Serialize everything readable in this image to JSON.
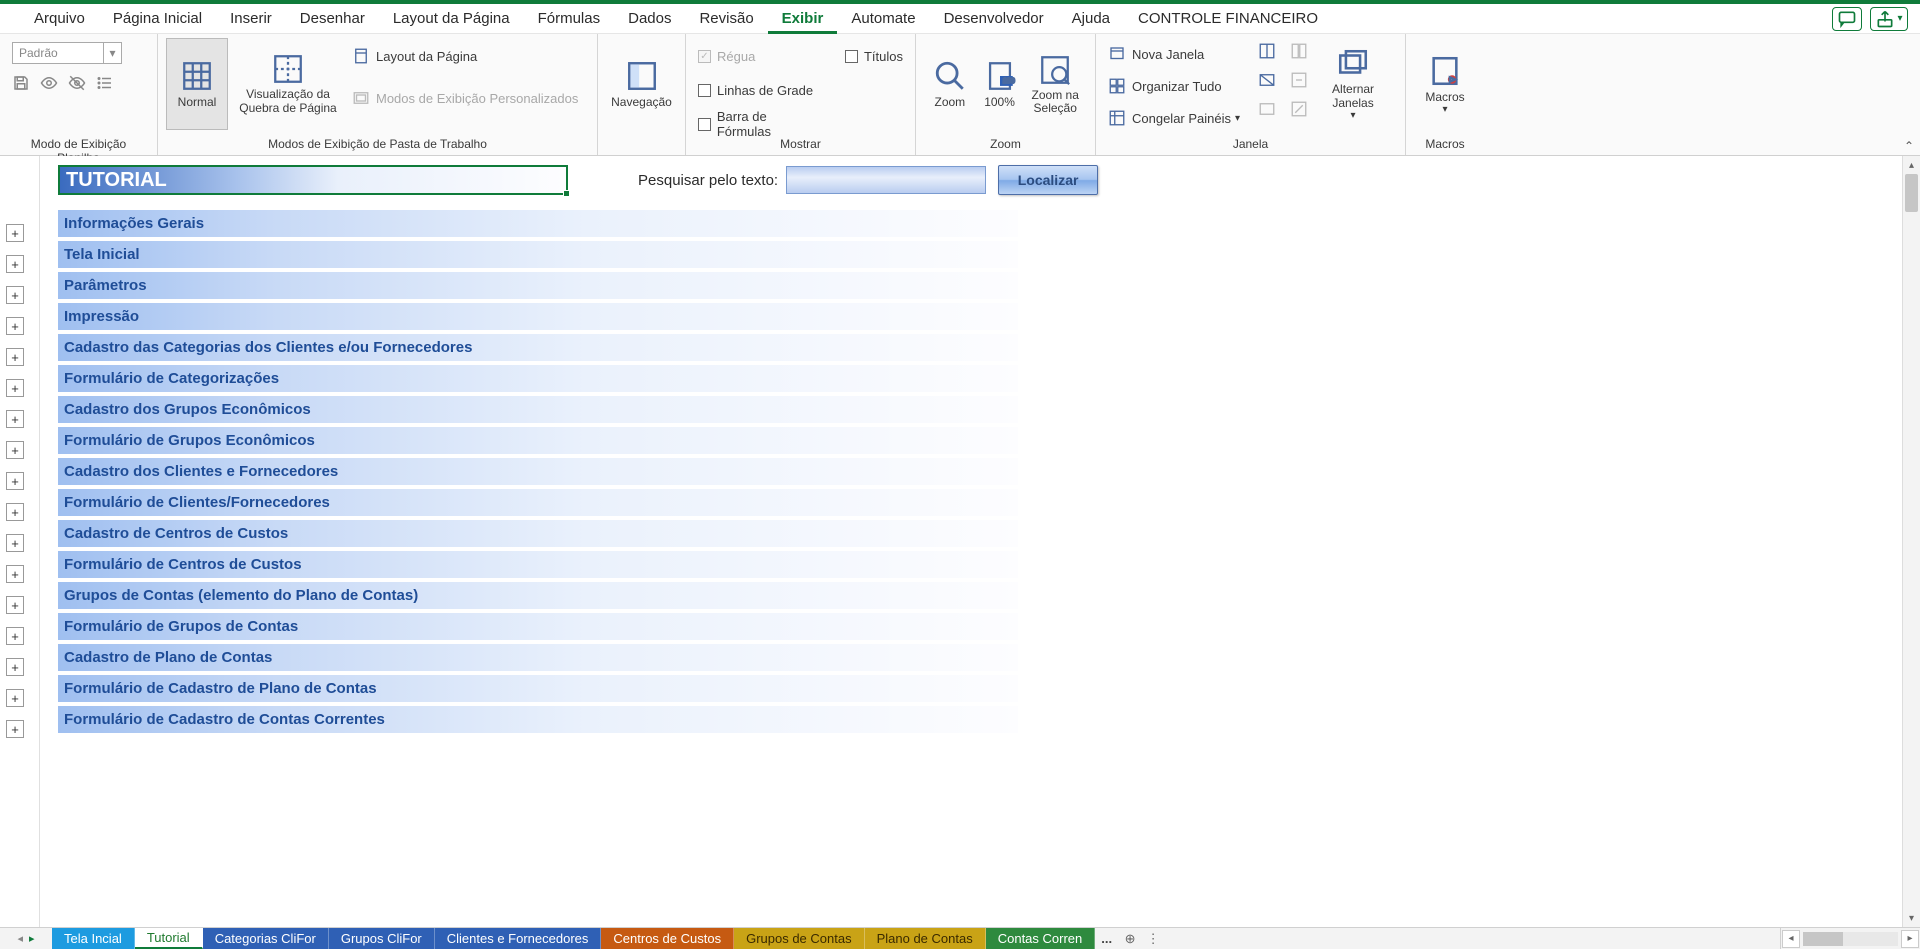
{
  "menubar": {
    "tabs": [
      "Arquivo",
      "Página Inicial",
      "Inserir",
      "Desenhar",
      "Layout da Página",
      "Fórmulas",
      "Dados",
      "Revisão",
      "Exibir",
      "Automate",
      "Desenvolvedor",
      "Ajuda",
      "CONTROLE FINANCEIRO"
    ],
    "active_index": 8
  },
  "ribbon": {
    "group1": {
      "label": "Modo de Exibição Planilha",
      "style_value": "Padrão"
    },
    "group2": {
      "label": "Modos de Exibição de Pasta de Trabalho",
      "normal": "Normal",
      "quebra": "Visualização da Quebra de Página",
      "layout": "Layout da Página",
      "personalizados": "Modos de Exibição Personalizados"
    },
    "group3": {
      "label": "",
      "navegacao": "Navegação"
    },
    "group4": {
      "label": "Mostrar",
      "regua": "Régua",
      "linhas": "Linhas de Grade",
      "barra": "Barra de Fórmulas",
      "titulos": "Títulos"
    },
    "group5": {
      "label": "Zoom",
      "zoom": "Zoom",
      "cem": "100%",
      "selecao": "Zoom na Seleção"
    },
    "group6": {
      "label": "Janela",
      "nova": "Nova Janela",
      "organizar": "Organizar Tudo",
      "congelar": "Congelar Painéis",
      "alternar": "Alternar Janelas"
    },
    "group7": {
      "label": "Macros",
      "macros": "Macros"
    }
  },
  "sheet": {
    "title_cell": "TUTORIAL",
    "search_label": "Pesquisar pelo texto:",
    "localizar": "Localizar",
    "sections": [
      "Informações Gerais",
      "Tela Inicial",
      "Parâmetros",
      "Impressão",
      "Cadastro das Categorias dos Clientes e/ou Fornecedores",
      "Formulário de Categorizações",
      "Cadastro dos Grupos Econômicos",
      "Formulário de Grupos Econômicos",
      "Cadastro dos Clientes e Fornecedores",
      "Formulário de Clientes/Fornecedores",
      "Cadastro de Centros de Custos",
      "Formulário de Centros de Custos",
      "Grupos de Contas (elemento do Plano de Contas)",
      "Formulário de Grupos de Contas",
      "Cadastro de Plano de Contas",
      "Formulário de Cadastro de Plano de Contas",
      "Formulário de Cadastro de Contas Correntes"
    ]
  },
  "tabs": {
    "items": [
      {
        "label": "Tela Incial",
        "bg": "#1d9be0",
        "fg": "#ffffff"
      },
      {
        "label": "Tutorial",
        "bg": "#ffffff",
        "fg": "#1f7a2e",
        "active": true
      },
      {
        "label": "Categorias CliFor",
        "bg": "#2f60b5",
        "fg": "#ffffff"
      },
      {
        "label": "Grupos CliFor",
        "bg": "#2f60b5",
        "fg": "#ffffff"
      },
      {
        "label": "Clientes e Fornecedores",
        "bg": "#2f60b5",
        "fg": "#ffffff"
      },
      {
        "label": "Centros de Custos",
        "bg": "#c65a12",
        "fg": "#ffffff"
      },
      {
        "label": "Grupos de Contas",
        "bg": "#c9a316",
        "fg": "#3a2a00"
      },
      {
        "label": "Plano de Contas",
        "bg": "#c9a316",
        "fg": "#3a2a00"
      },
      {
        "label": "Contas Corren",
        "bg": "#2e8a3e",
        "fg": "#ffffff"
      }
    ],
    "overflow": "..."
  }
}
